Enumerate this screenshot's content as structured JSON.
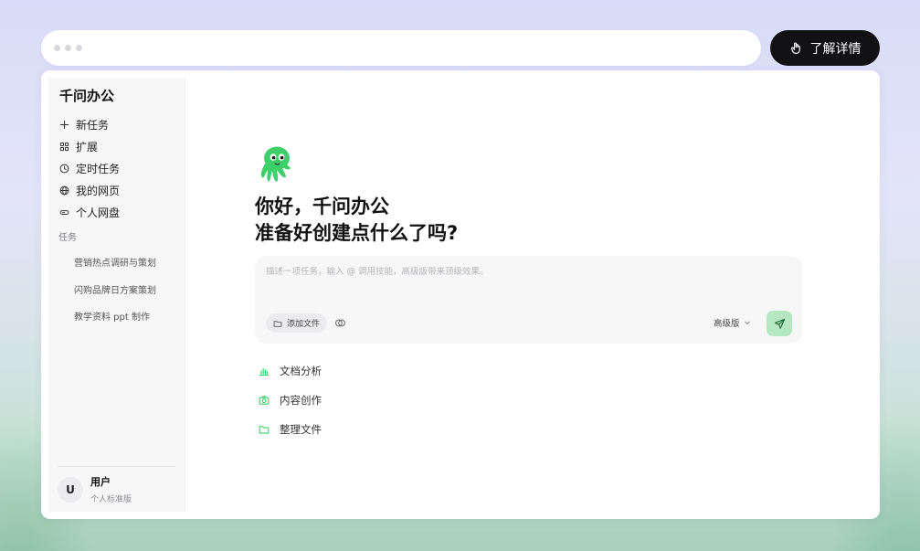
{
  "header": {
    "learn_more_label": "了解详情"
  },
  "sidebar": {
    "title": "千问办公",
    "nav": [
      {
        "label": "新任务",
        "icon": "plus-icon"
      },
      {
        "label": "扩展",
        "icon": "grid-icon"
      },
      {
        "label": "定时任务",
        "icon": "clock-icon"
      },
      {
        "label": "我的网页",
        "icon": "globe-icon"
      },
      {
        "label": "个人网盘",
        "icon": "drive-icon"
      }
    ],
    "tasks_section_label": "任务",
    "tasks": [
      "营销热点调研与策划",
      "闪购品牌日方案策划",
      "教学资料 ppt 制作"
    ],
    "user": {
      "avatar_initial": "U",
      "name": "用户",
      "plan": "个人标准版"
    }
  },
  "main": {
    "greeting_line1": "你好，千问办公",
    "greeting_line2": "准备好创建点什么了吗?",
    "composer": {
      "placeholder": "描述一项任务，输入 @ 调用技能，高级版带来顶级效果。",
      "value": "",
      "attach_label": "添加文件",
      "model_label": "高级版"
    },
    "quick_actions": [
      {
        "label": "文档分析",
        "icon": "bar-chart-icon"
      },
      {
        "label": "内容创作",
        "icon": "camera-icon"
      },
      {
        "label": "整理文件",
        "icon": "folder-icon"
      }
    ]
  },
  "colors": {
    "accent_green": "#3ecf6a",
    "send_button_bg": "#b5e8c2",
    "learn_button_bg": "#111114"
  }
}
